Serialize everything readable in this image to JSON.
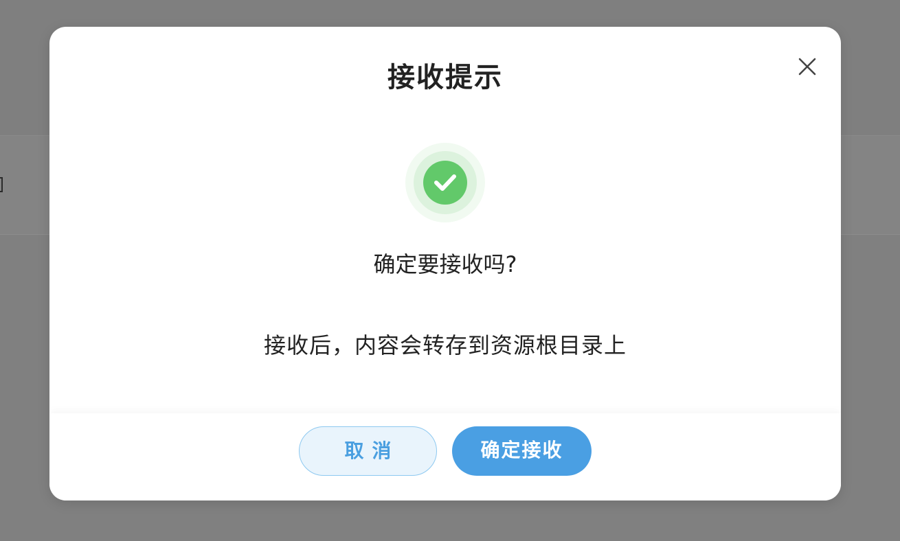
{
  "dialog": {
    "title": "接收提示",
    "question": "确定要接收吗?",
    "description": "接收后，内容会转存到资源根目录上",
    "cancel_label": "取消",
    "confirm_label": "确定接收",
    "close_icon": "close-icon",
    "status_icon": "check-circle-icon"
  },
  "colors": {
    "success": "#62c96a",
    "primary": "#4a9fe3",
    "cancel_bg": "#e9f4fc",
    "overlay": "#808080"
  }
}
